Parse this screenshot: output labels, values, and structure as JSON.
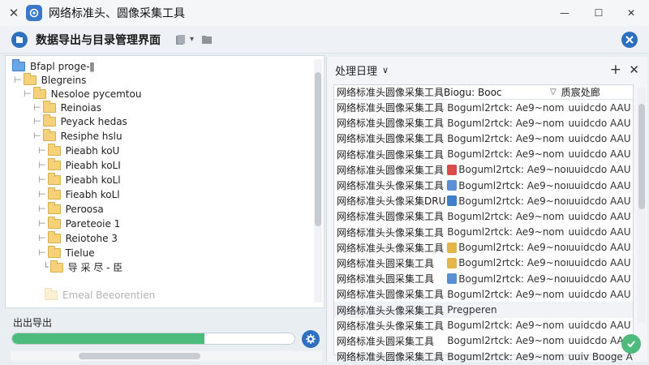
{
  "window": {
    "title": "网络标准头、圆像采集工具",
    "minimize_glyph": "—",
    "maximize_glyph": "☐",
    "close_glyph": "✕",
    "left_close_glyph": "✕"
  },
  "toolbar": {
    "title": "数据导出与目录管理界面",
    "dropdown_glyph": "▾"
  },
  "tree": {
    "items": [
      {
        "label": "Bfapl proge-ǁ",
        "connector": "",
        "folder_color": "blue"
      },
      {
        "label": "Blegreins",
        "connector": "⊢",
        "folder_color": "yellow"
      },
      {
        "label": "Nesoloe pycemtou",
        "connector": "⊢",
        "folder_color": "yellow"
      },
      {
        "label": "Reinoias",
        "connector": "⊢",
        "folder_color": "yellow"
      },
      {
        "label": "Peyack hedas",
        "connector": "⊢",
        "folder_color": "yellow"
      },
      {
        "label": "Resiphe hslu",
        "connector": "⊢",
        "folder_color": "yellow"
      },
      {
        "label": "Pieabh koU",
        "connector": "⊢",
        "folder_color": "yellow"
      },
      {
        "label": "Pieabh koLI",
        "connector": "⊢",
        "folder_color": "yellow"
      },
      {
        "label": "Pieabh koLl",
        "connector": "⊢",
        "folder_color": "yellow"
      },
      {
        "label": "Fieabh koLl",
        "connector": "⊢",
        "folder_color": "yellow"
      },
      {
        "label": "Peroosa",
        "connector": "⊢",
        "folder_color": "yellow"
      },
      {
        "label": "Pareteoie 1",
        "connector": "⊢",
        "folder_color": "yellow"
      },
      {
        "label": "Reiotohe 3",
        "connector": "⊢",
        "folder_color": "yellow"
      },
      {
        "label": "Tielue",
        "connector": "⊢",
        "folder_color": "yellow"
      },
      {
        "label": "导 采 尽 - 臣",
        "connector": "└",
        "folder_color": "yellow"
      },
      {
        "label": "Emeal Beeorentien",
        "connector": "",
        "folder_color": "yellow"
      }
    ]
  },
  "export": {
    "label": "出出导出",
    "progress_percent": 68
  },
  "right_panel": {
    "title": "处理日理",
    "chevron_glyph": "∨",
    "plus_glyph": "+",
    "close_glyph": "✕",
    "table_header": {
      "col1": "网络标准头圆像采集工具",
      "col2": "Biogu: Booc",
      "col3_icon": "▽",
      "col3": "质宸处廊"
    },
    "rows": [
      {
        "col1": "网络标准头圆像采集工具",
        "col2": "Boguml2rtck: Ae9~nom",
        "col3": "uuidcdo AAU",
        "icon_color": ""
      },
      {
        "col1": "网络标准头圆像采集工具",
        "col2": "Boguml2rtck: Ae9~nom",
        "col3": "uuidcdo AAU",
        "icon_color": ""
      },
      {
        "col1": "网络标准头圆像采集工具",
        "col2": "Boguml2rtck: Ae9~nom",
        "col3": "uuidcdo AAU",
        "icon_color": ""
      },
      {
        "col1": "网络标准头圆像采集工具",
        "col2": "Boguml2rtck: Ae9~nom",
        "col3": "uuidcdo AAU",
        "icon_color": ""
      },
      {
        "col1": "网络标准头圆像采集工具",
        "col2": "Boguml2rtck: Ae9~nom",
        "col3": "uuidcdo AAU",
        "icon_color": "#d94b4b"
      },
      {
        "col1": "网络标准头头像采集工具",
        "col2": "Boguml2rtck: Ae9~nom",
        "col3": "uuidcdo AAU",
        "icon_color": "#5a8fd6"
      },
      {
        "col1": "网络标准头头像采集DRU",
        "col2": "Boguml2rtck: Ae9~nom",
        "col3": "uuidcdo AAU",
        "icon_color": "#3f7fc8"
      },
      {
        "col1": "网络标准头圆像采集工具",
        "col2": "Boguml2rtck: Ae9~nom",
        "col3": "uuidcdo AAU",
        "icon_color": ""
      },
      {
        "col1": "网络标准头头像采集工具",
        "col2": "Boguml2rtck: Ae9~nom",
        "col3": "uuidcdo AAU",
        "icon_color": ""
      },
      {
        "col1": "网络标准头头像采集工具",
        "col2": "Boguml2rtck: Ae9~nom",
        "col3": "uuidcdo AAU",
        "icon_color": "#e3b54a"
      },
      {
        "col1": "网络标准头圆采集工具",
        "col2": "Boguml2rtck: Ae9~nom",
        "col3": "uuidcdo AAU",
        "icon_color": "#e3b54a"
      },
      {
        "col1": "网络标准头圆采集工具",
        "col2": "Boguml2rtck: Ae9~nom",
        "col3": "uuidcdo AAU",
        "icon_color": "#5a8fd6"
      },
      {
        "col1": "网络标准头圆像采集工具",
        "col2": "Boguml2rtck: Ae9~nom",
        "col3": "uuidcdo AAU",
        "icon_color": ""
      },
      {
        "col1": "网络标准头头像采集工具",
        "col2": "Pregperen",
        "col3": "",
        "icon_color": ""
      },
      {
        "col1": "网络标准头头像采集工具",
        "col2": "Boguml2rtck: Ae9~nom",
        "col3": "uuidcdo AAU",
        "icon_color": ""
      },
      {
        "col1": "网络标准头圆采集工具",
        "col2": "Boguml2rtck: Ae9~nom",
        "col3": "uuidcdo AAU",
        "icon_color": ""
      },
      {
        "col1": "网络标准头圆像采集工具",
        "col2": "Boguml2rtck: Ae9~nom",
        "col3": "uuiv Booge AAU",
        "icon_color": ""
      }
    ]
  }
}
